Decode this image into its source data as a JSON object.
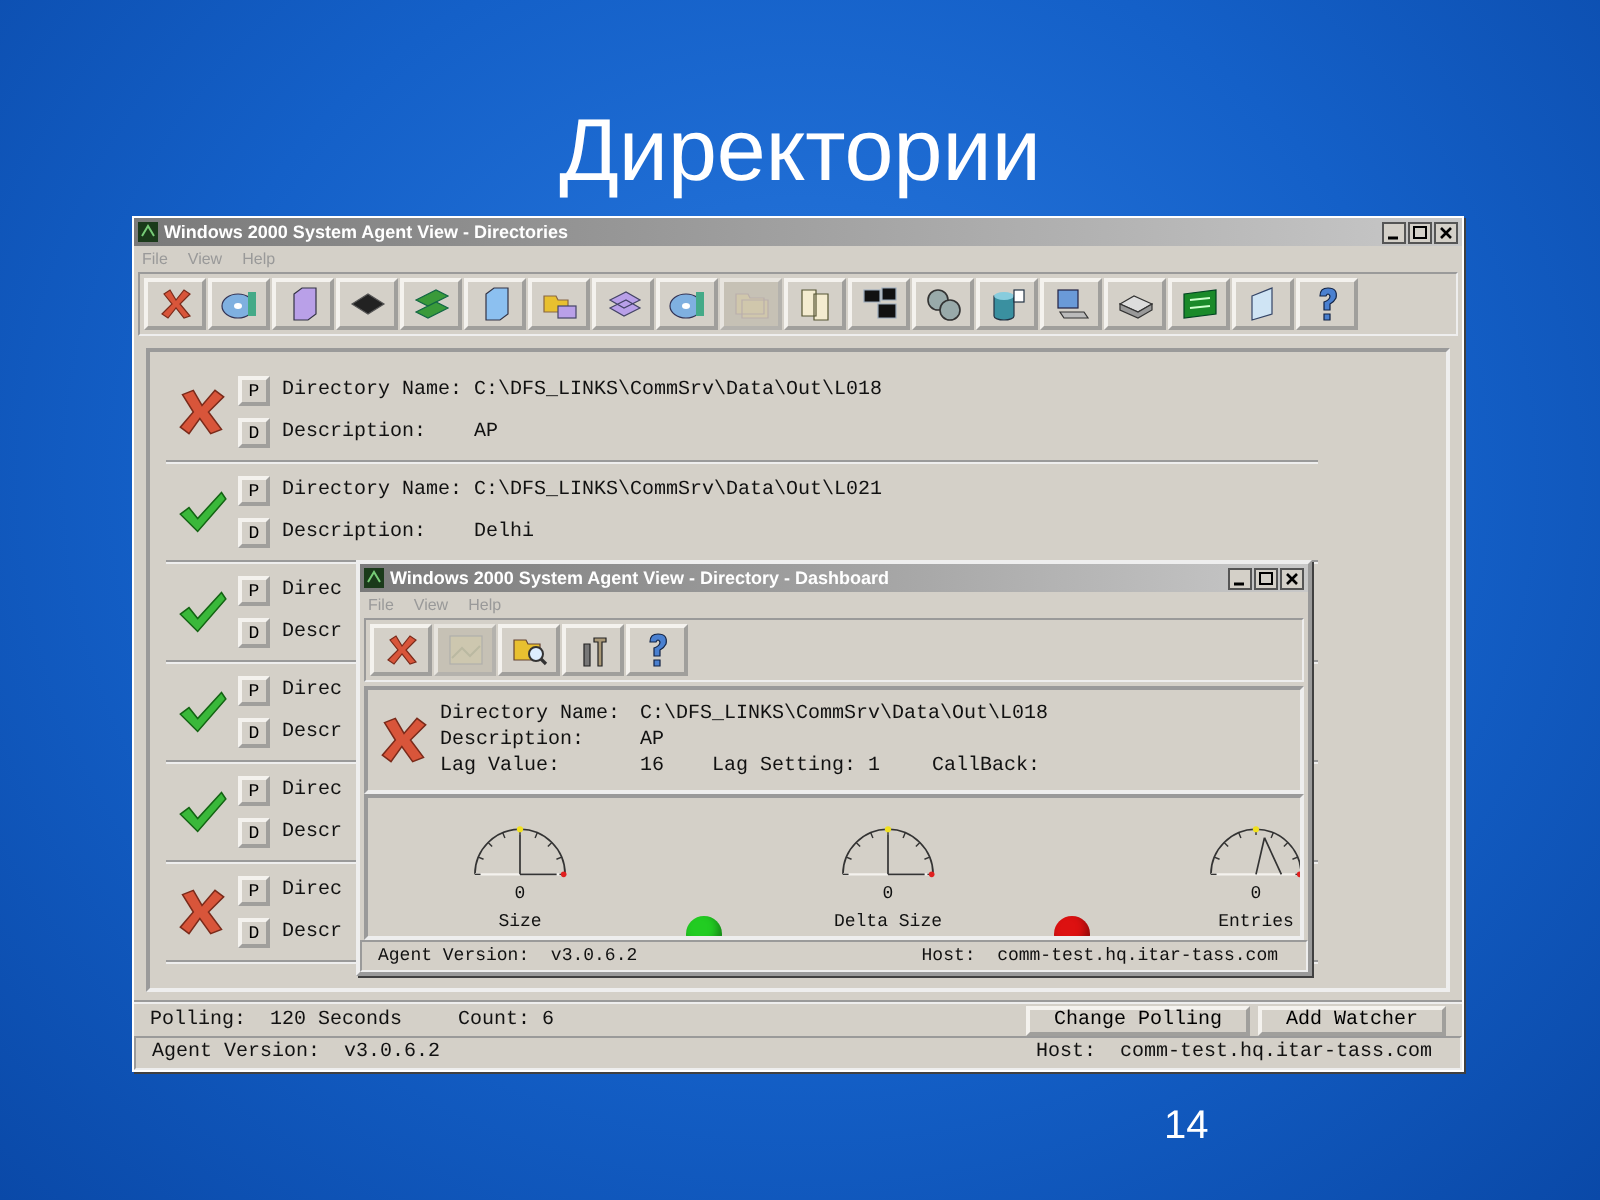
{
  "slide": {
    "title": "Директории",
    "page_number": "14"
  },
  "main_window": {
    "title": "Windows 2000 System Agent View - Directories",
    "menu": [
      "File",
      "View",
      "Help"
    ],
    "toolbar": [
      {
        "disabled": false
      },
      {
        "disabled": false
      },
      {
        "disabled": false
      },
      {
        "disabled": false
      },
      {
        "disabled": false
      },
      {
        "disabled": false
      },
      {
        "disabled": false
      },
      {
        "disabled": false
      },
      {
        "disabled": false
      },
      {
        "disabled": true
      },
      {
        "disabled": false
      },
      {
        "disabled": false
      },
      {
        "disabled": false
      },
      {
        "disabled": false
      },
      {
        "disabled": false
      },
      {
        "disabled": false
      },
      {
        "disabled": false
      },
      {
        "disabled": false
      },
      {
        "disabled": false
      }
    ],
    "rows": [
      {
        "failed": true,
        "p_button": "P",
        "d_button": "D",
        "name_label": "Directory Name:",
        "name": "C:\\DFS_LINKS\\CommSrv\\Data\\Out\\L018",
        "description_label": "Description:",
        "description": "AP"
      },
      {
        "failed": false,
        "p_button": "P",
        "d_button": "D",
        "name_label": "Directory Name:",
        "name": "C:\\DFS_LINKS\\CommSrv\\Data\\Out\\L021",
        "description_label": "Description:",
        "description": "Delhi"
      },
      {
        "failed": false,
        "p_button": "P",
        "d_button": "D",
        "name_label": "Direc",
        "description_label": "Descr"
      },
      {
        "failed": false,
        "p_button": "P",
        "d_button": "D",
        "name_label": "Direc",
        "description_label": "Descr"
      },
      {
        "failed": false,
        "p_button": "P",
        "d_button": "D",
        "name_label": "Direc",
        "description_label": "Descr"
      },
      {
        "failed": true,
        "p_button": "P",
        "d_button": "D",
        "name_label": "Direc",
        "description_label": "Descr"
      }
    ],
    "status_bar": {
      "polling": "Polling:  120 Seconds",
      "count": "Count: 6",
      "buttons": [
        "Change Polling",
        "Add Watcher"
      ],
      "agent_version": "Agent Version:  v3.0.6.2",
      "host": "Host:  comm-test.hq.itar-tass.com"
    }
  },
  "dialog": {
    "title": "Windows 2000 System Agent View - Directory - Dashboard",
    "menu": [
      "File",
      "View",
      "Help"
    ],
    "toolbar": [
      {
        "disabled": false
      },
      {
        "disabled": true
      },
      {
        "disabled": false
      },
      {
        "disabled": false
      },
      {
        "disabled": false
      }
    ],
    "info": {
      "failed": true,
      "name_label": "Directory Name:",
      "name": "C:\\DFS_LINKS\\CommSrv\\Data\\Out\\L018",
      "description_label": "Description:",
      "description": "AP",
      "lag_value_label": "Lag Value:",
      "lag_value": "16",
      "lag_setting": "Lag Setting: 1",
      "callback": "CallBack:"
    },
    "gauges": [
      {
        "label": "Size",
        "reading": "0"
      },
      {
        "label": "Delta Size",
        "reading": "0"
      },
      {
        "label": "Entries",
        "reading": "0"
      }
    ],
    "lights": [
      {
        "color": "#22cc22"
      },
      {
        "color": "#dd1111"
      }
    ],
    "status_bar": {
      "agent_version": "Agent Version:  v3.0.6.2",
      "host": "Host:  comm-test.hq.itar-tass.com"
    }
  }
}
